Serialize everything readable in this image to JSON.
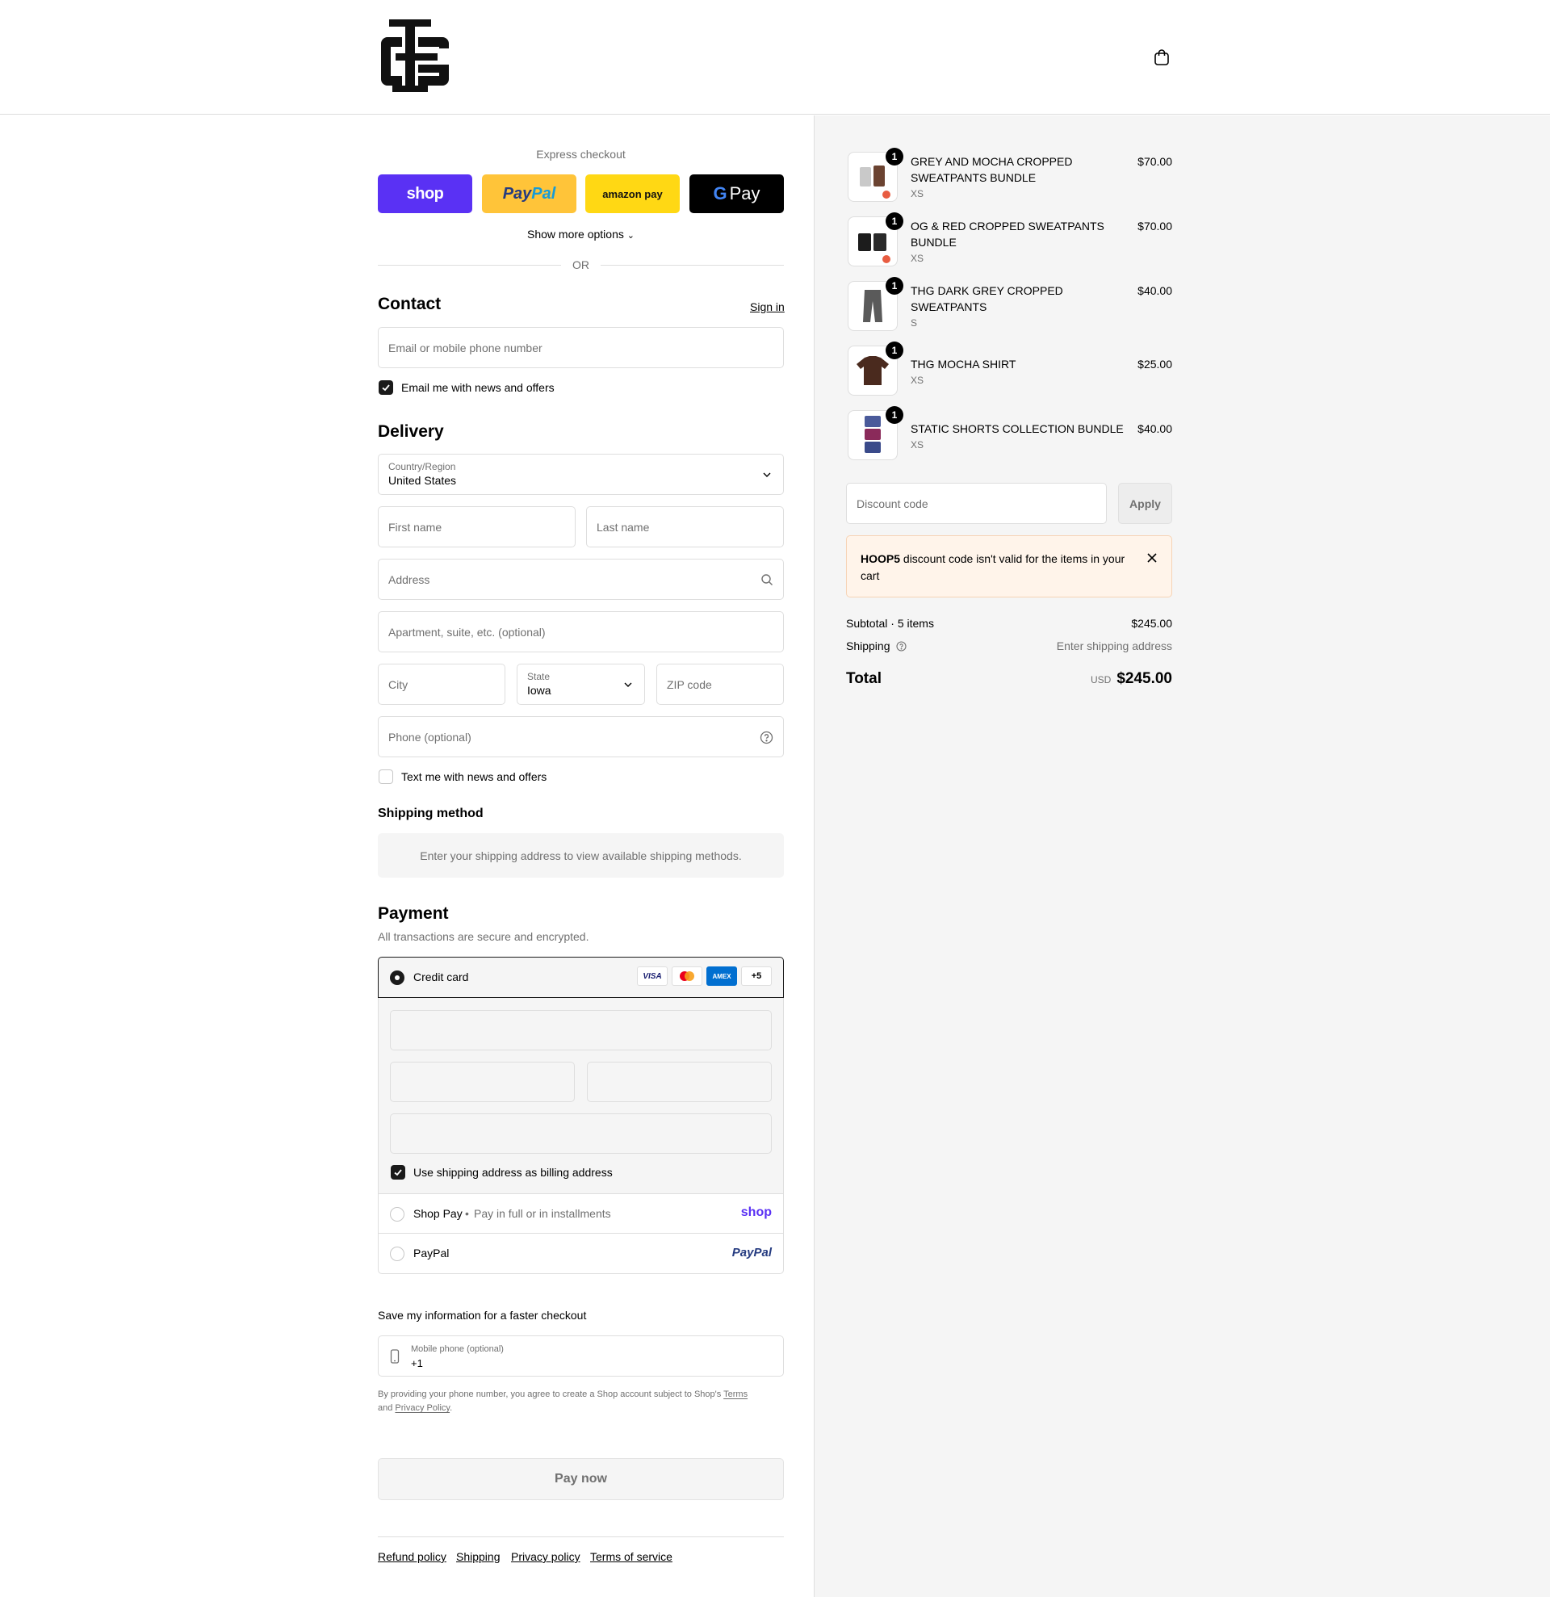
{
  "header": {
    "logo_alt": "THG"
  },
  "express": {
    "title": "Express checkout",
    "buttons": {
      "shop": "shop",
      "paypal": "PayPal",
      "amazon_pay": "amazon pay",
      "gpay": "Pay"
    },
    "show_more": "Show more options",
    "or": "OR"
  },
  "contact": {
    "title": "Contact",
    "sign_in": "Sign in",
    "email_placeholder": "Email or mobile phone number",
    "news_label": "Email me with news and offers"
  },
  "delivery": {
    "title": "Delivery",
    "country_label": "Country/Region",
    "country_value": "United States",
    "first_name": "First name",
    "last_name": "Last name",
    "address": "Address",
    "apartment": "Apartment, suite, etc. (optional)",
    "city": "City",
    "state_label": "State",
    "state_value": "Iowa",
    "zip": "ZIP code",
    "phone": "Phone (optional)",
    "text_label": "Text me with news and offers"
  },
  "shipping_method": {
    "title": "Shipping method",
    "note": "Enter your shipping address to view available shipping methods."
  },
  "payment": {
    "title": "Payment",
    "subtitle": "All transactions are secure and encrypted.",
    "credit_card": "Credit card",
    "cards": {
      "visa": "VISA",
      "amex": "AMEX",
      "more": "+5"
    },
    "billing_label": "Use shipping address as billing address",
    "shop_pay": "Shop Pay",
    "shop_pay_desc": "Pay in full or in installments",
    "shop_logo": "shop",
    "paypal": "PayPal",
    "paypal_logo": "PayPal"
  },
  "save_info": {
    "title": "Save my information for a faster checkout",
    "phone_label": "Mobile phone (optional)",
    "phone_value": "+1",
    "legal_pre": "By providing your phone number, you agree to create a Shop account subject to Shop's ",
    "terms": "Terms",
    "and": "and ",
    "privacy": "Privacy Policy",
    "period": "."
  },
  "pay_now": "Pay now",
  "footer": {
    "links": [
      "Refund policy",
      "Shipping",
      "Privacy policy",
      "Terms of service"
    ]
  },
  "summary": {
    "items": [
      {
        "qty": "1",
        "name": "GREY AND MOCHA CROPPED SWEATPANTS BUNDLE",
        "variant": "XS",
        "price": "$70.00"
      },
      {
        "qty": "1",
        "name": "OG & RED CROPPED SWEATPANTS BUNDLE",
        "variant": "XS",
        "price": "$70.00"
      },
      {
        "qty": "1",
        "name": "THG DARK GREY CROPPED SWEATPANTS",
        "variant": "S",
        "price": "$40.00"
      },
      {
        "qty": "1",
        "name": "THG MOCHA SHIRT",
        "variant": "XS",
        "price": "$25.00"
      },
      {
        "qty": "1",
        "name": "STATIC SHORTS COLLECTION BUNDLE",
        "variant": "XS",
        "price": "$40.00"
      }
    ],
    "discount_placeholder": "Discount code",
    "apply": "Apply",
    "error_code": "HOOP5",
    "error_msg": " discount code isn't valid for the items in your cart",
    "subtotal_label": "Subtotal · 5 items",
    "subtotal_value": "$245.00",
    "shipping_label": "Shipping",
    "shipping_value": "Enter shipping address",
    "total_label": "Total",
    "currency": "USD",
    "total_value": "$245.00"
  },
  "colors": {
    "shop": "#5a31f4",
    "paypal": "#ffc439",
    "amazon": "#ffd814",
    "gpay": "#000000",
    "error_bg": "#fff4ea",
    "error_border": "#f6d3b5"
  }
}
